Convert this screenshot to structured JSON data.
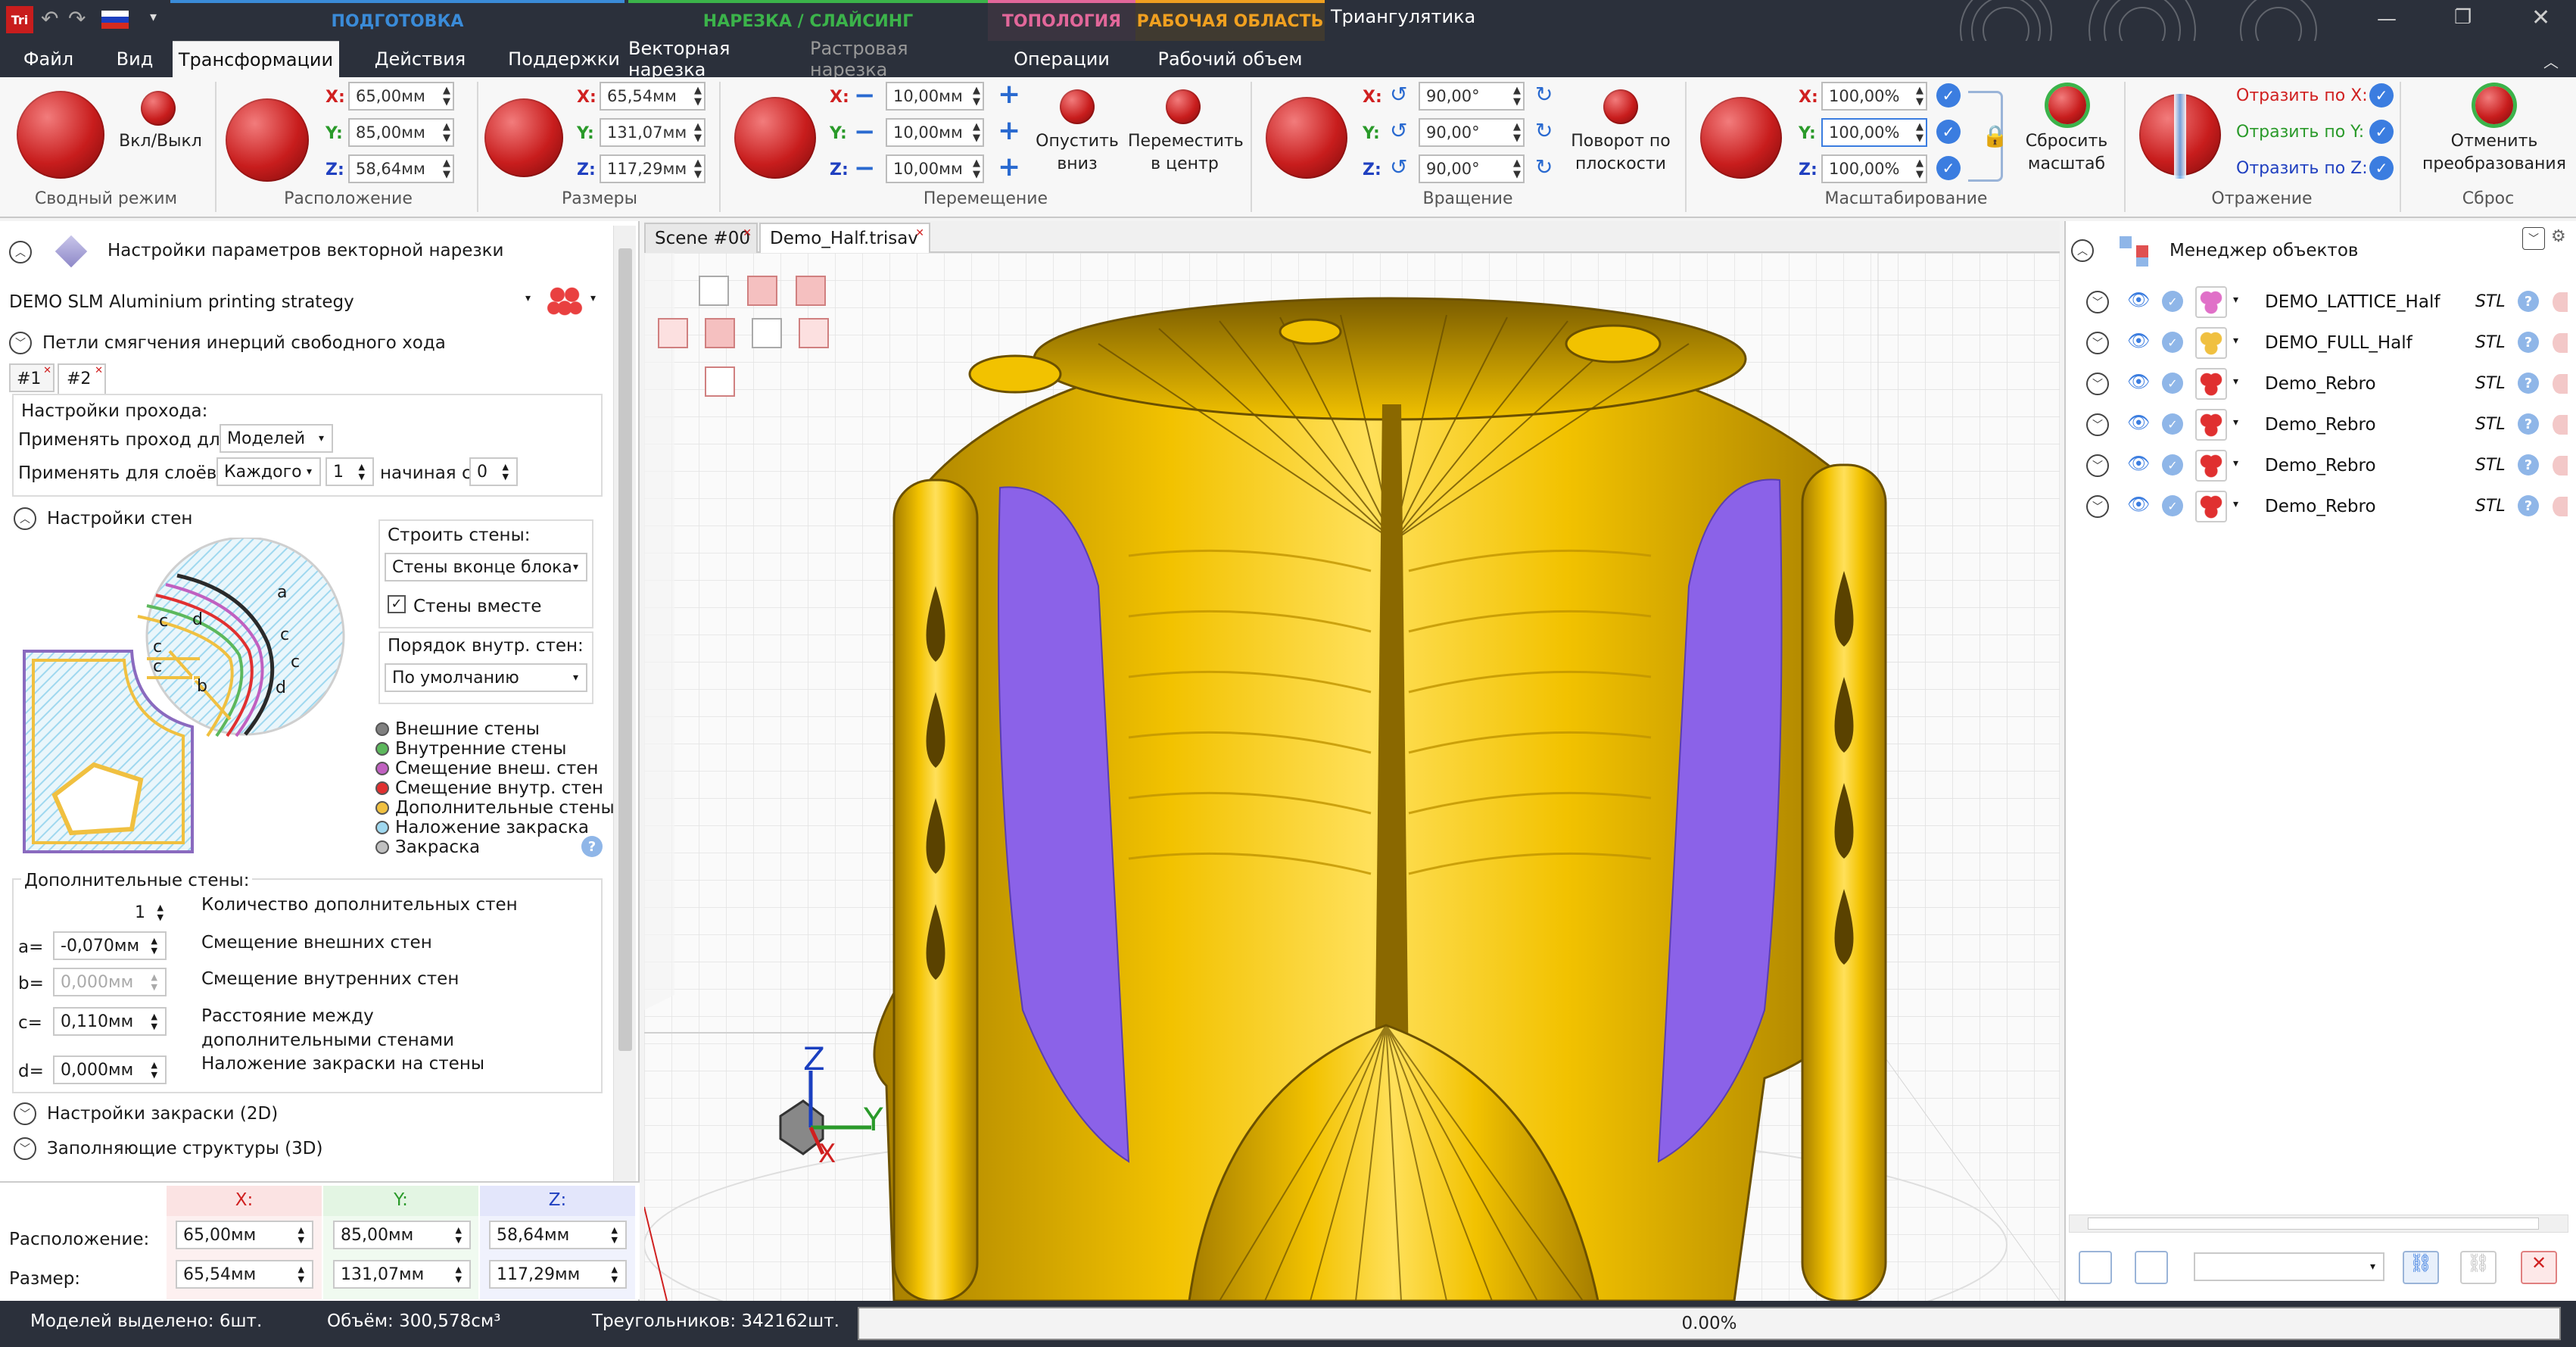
{
  "app": {
    "title": "Триангулятика",
    "logo": "Tri"
  },
  "context_tabs": [
    {
      "label": "ПОДГОТОВКА",
      "color": "#3a8bd8"
    },
    {
      "label": "НАРЕЗКА / СЛАЙСИНГ",
      "color": "#3bb34a"
    },
    {
      "label": "ТОПОЛОГИЯ",
      "color": "#e2679a"
    },
    {
      "label": "РАБОЧАЯ ОБЛАСТЬ",
      "color": "#f0a020"
    }
  ],
  "menu": {
    "file": "Файл",
    "view": "Вид",
    "transforms": "Трансформации",
    "actions": "Действия",
    "supports": "Поддержки",
    "vector_slicing": "Векторная нарезка",
    "raster_slicing": "Растровая нарезка",
    "operations": "Операции",
    "work_volume": "Рабочий объем"
  },
  "ribbon": {
    "summary": {
      "toggle_label": "Вкл/Выкл",
      "group": "Сводный режим"
    },
    "position": {
      "group": "Расположение",
      "x": "65,00мм",
      "y": "85,00мм",
      "z": "58,64мм"
    },
    "size": {
      "group": "Размеры",
      "x": "65,54мм",
      "y": "131,07мм",
      "z": "117,29мм"
    },
    "move": {
      "group": "Перемещение",
      "x": "10,00мм",
      "y": "10,00мм",
      "z": "10,00мм",
      "drop_label": "Опустить вниз",
      "center_label": "Переместить в центр"
    },
    "rotate": {
      "group": "Вращение",
      "x": "90,00°",
      "y": "90,00°",
      "z": "90,00°",
      "plane_label": "Поворот по плоскости"
    },
    "scale": {
      "group": "Масштабирование",
      "x": "100,00%",
      "y": "100,00%",
      "z": "100,00%",
      "reset_label": "Сбросить масштаб"
    },
    "mirror": {
      "group": "Отражение",
      "x": "Отразить по X:",
      "y": "Отразить по Y:",
      "z": "Отразить по Z:"
    },
    "reset": {
      "group": "Сброс",
      "cancel_label": "Отменить преобразования"
    },
    "axis": {
      "x": "X:",
      "y": "Y:",
      "z": "Z:"
    }
  },
  "left": {
    "header": "Настройки параметров векторной нарезки",
    "strategy": "DEMO SLM Aluminium printing strategy",
    "section_inertia": "Петли смягчения инерций свободного хода",
    "pass_tabs": [
      "#1",
      "#2"
    ],
    "pass_settings": "Настройки прохода:",
    "apply_pass_for": "Применять проход для:",
    "apply_pass_value": "Моделей",
    "apply_for_layers": "Применять для слоёв:",
    "layers_value": "Каждого",
    "layers_n": "1",
    "starting_from": "начиная с",
    "start_value": "0",
    "wall_settings": "Настройки стен",
    "build_walls": "Строить стены:",
    "build_walls_value": "Стены вконце блока",
    "walls_together": "Стены вместе",
    "inner_order": "Порядок внутр. стен:",
    "inner_order_value": "По умолчанию",
    "legend": [
      "Внешние стены",
      "Внутренние стены",
      "Смещение внеш. стен",
      "Смещение внутр. стен",
      "Дополнительные стены",
      "Наложение закраска",
      "Закраска"
    ],
    "legend_colors": [
      "#808080",
      "#5cb85c",
      "#c060c0",
      "#e03030",
      "#f0c040",
      "#9fd8ef",
      "#c0c0c0"
    ],
    "extra_walls": "Дополнительные стены:",
    "extra_count": "1",
    "extra_count_label": "Количество дополнительных стен",
    "a_label": "a=",
    "a_value": "-0,070мм",
    "a_desc": "Смещение внешних стен",
    "b_label": "b=",
    "b_value": "0,000мм",
    "b_desc": "Смещение внутренних стен",
    "c_label": "c=",
    "c_value": "0,110мм",
    "c_desc": "Расстояние между дополнительными стенами",
    "d_label": "d=",
    "d_value": "0,000мм",
    "d_desc": "Наложение закраски на стены",
    "fill_2d": "Настройки закраски (2D)",
    "fill_3d": "Заполняющие структуры (3D)",
    "diagram_letters": [
      "a",
      "b",
      "c",
      "d",
      "c",
      "c",
      "c",
      "d",
      "b",
      "c"
    ]
  },
  "bottom_table": {
    "x": "X:",
    "y": "Y:",
    "z": "Z:",
    "position_label": "Расположение:",
    "size_label": "Размер:",
    "pos": [
      "65,00мм",
      "85,00мм",
      "58,64мм"
    ],
    "size": [
      "65,54мм",
      "131,07мм",
      "117,29мм"
    ]
  },
  "doc_tabs": [
    "Scene #00",
    "Demo_Half.trisav"
  ],
  "axes": {
    "x": "X",
    "y": "Y",
    "z": "Z"
  },
  "right": {
    "header": "Менеджер объектов",
    "objects": [
      {
        "name": "DEMO_LATTICE_Half",
        "type": "STL"
      },
      {
        "name": "DEMO_FULL_Half",
        "type": "STL"
      },
      {
        "name": "Demo_Rebro",
        "type": "STL"
      },
      {
        "name": "Demo_Rebro",
        "type": "STL"
      },
      {
        "name": "Demo_Rebro",
        "type": "STL"
      },
      {
        "name": "Demo_Rebro",
        "type": "STL"
      }
    ]
  },
  "status": {
    "selected": "Моделей выделено: 6шт.",
    "volume": "Объём: 300,578см³",
    "triangles": "Треугольников: 342162шт.",
    "progress": "0.00%"
  },
  "colors": {
    "accent": "#3b7de0",
    "titlebar": "#2b303b",
    "model_yellow": "#f2c200",
    "section_purple": "#8b62e8"
  }
}
